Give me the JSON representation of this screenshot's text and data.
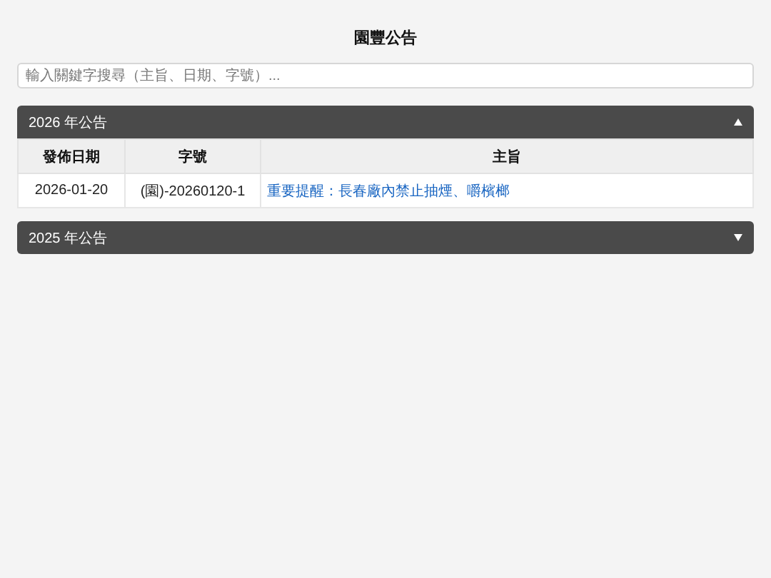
{
  "title": "園豐公告",
  "search": {
    "placeholder": "輸入關鍵字搜尋（主旨、日期、字號）..."
  },
  "sections": [
    {
      "heading": "2026 年公告",
      "expanded": true,
      "table": {
        "columns": [
          "發佈日期",
          "字號",
          "主旨"
        ],
        "rows": [
          {
            "date": "2026-01-20",
            "number": "(園)-20260120-1",
            "subject": "重要提醒：長春廠內禁止抽煙、嚼檳榔"
          }
        ]
      }
    },
    {
      "heading": "2025 年公告",
      "expanded": false
    }
  ]
}
